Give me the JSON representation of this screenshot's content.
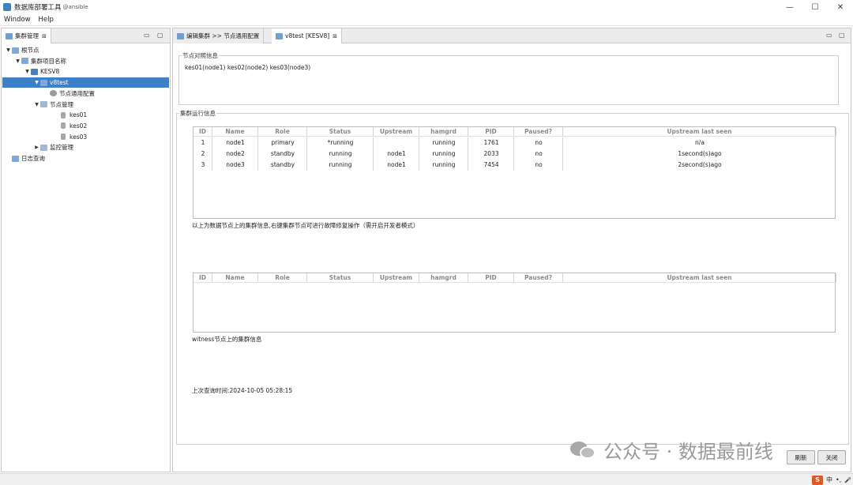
{
  "window": {
    "title": "数据库部署工具",
    "user": "@ansible",
    "min": "—",
    "max": "☐",
    "close": "✕"
  },
  "menu": [
    "Window",
    "Help"
  ],
  "left_view": {
    "tab_label": "集群管理",
    "tab_close": "⊠",
    "ctl_min": "▭",
    "ctl_max": "▢",
    "tree": [
      {
        "label": "根节点",
        "depth": 0,
        "twisty": "▼",
        "icon": "folder",
        "selected": false
      },
      {
        "label": "集群项目名称",
        "depth": 1,
        "twisty": "▼",
        "icon": "folder",
        "selected": false
      },
      {
        "label": "KESV8",
        "depth": 2,
        "twisty": "▼",
        "icon": "cube",
        "selected": false
      },
      {
        "label": "v8test",
        "depth": 3,
        "twisty": "▼",
        "icon": "folder",
        "selected": true
      },
      {
        "label": "节点通用配置",
        "depth": 4,
        "twisty": "",
        "icon": "gear",
        "selected": false
      },
      {
        "label": "节点管理",
        "depth": 4,
        "twisty": "▼",
        "icon": "doc",
        "selected": false,
        "shift": -1
      },
      {
        "label": "kes01",
        "depth": 5,
        "twisty": "",
        "icon": "db",
        "selected": false
      },
      {
        "label": "kes02",
        "depth": 5,
        "twisty": "",
        "icon": "db",
        "selected": false
      },
      {
        "label": "kes03",
        "depth": 5,
        "twisty": "",
        "icon": "db",
        "selected": false
      },
      {
        "label": "监控管理",
        "depth": 4,
        "twisty": "▶",
        "icon": "doc",
        "selected": false,
        "shift": -1
      },
      {
        "label": "日志查询",
        "depth": 1,
        "twisty": "",
        "icon": "folder",
        "selected": false,
        "shift": -1
      }
    ]
  },
  "editor": {
    "tabs": [
      {
        "label": "编辑集群 >> 节点通用配置",
        "active": false
      },
      {
        "label": "v8test [KESV8]",
        "active": true,
        "close": "⊠"
      }
    ],
    "ctl_min": "▭",
    "ctl_max": "▢",
    "mapping_group": {
      "title": "节点对照信息",
      "text": "kes01(node1)   kes02(node2)      kes03(node3)"
    },
    "run_group": {
      "title": "集群运行信息"
    },
    "columns": [
      "ID",
      "Name",
      "Role",
      "Status",
      "Upstream",
      "hamgrd",
      "PID",
      "Paused?",
      "Upstream last seen"
    ],
    "rows": [
      [
        "1",
        "node1",
        "primary",
        "*running",
        "",
        "running",
        "1761",
        "no",
        "n/a"
      ],
      [
        "2",
        "node2",
        "standby",
        "running",
        "node1",
        "running",
        "2033",
        "no",
        "1second(s)ago"
      ],
      [
        "3",
        "node3",
        "standby",
        "running",
        "node1",
        "running",
        "7454",
        "no",
        "2second(s)ago"
      ]
    ],
    "table1_note": "以上为数据节点上的集群信息,右键集群节点可进行故障修复操作（需开启开发者模式）",
    "witness_columns": [
      "ID",
      "Name",
      "Role",
      "Status",
      "Upstream",
      "hamgrd",
      "PID",
      "Paused?",
      "Upstream last seen"
    ],
    "witness_rows": [],
    "table2_note": "witness节点上的集群信息",
    "last_query": "上次查询时间:2024-10-05 05:28:15",
    "refresh_button": "刷新",
    "close_button": "关闭"
  },
  "watermark": "公众号 · 数据最前线",
  "tray": {
    "ime": "S",
    "lang": "中",
    "dot": "•,",
    "mic": "🎤"
  }
}
